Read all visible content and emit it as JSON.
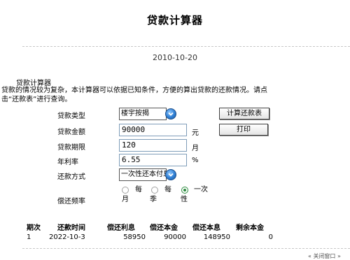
{
  "page": {
    "title": "贷款计算器",
    "date": "2010-10-20"
  },
  "intro": {
    "heading": "贷款计算器",
    "description": "贷款的情况较为复杂，本计算器可以依据已知条件，方便的算出贷款的还款情况。请点击“还款表”进行查询。"
  },
  "form": {
    "loan_type_label": "贷款类型",
    "loan_type_value": "楼宇按揭",
    "amount_label": "贷款金额",
    "amount_value": "90000",
    "amount_unit": "元",
    "term_label": "贷款期限",
    "term_value": "120",
    "term_unit": "月",
    "rate_label": "年利率",
    "rate_value": "6.55",
    "rate_unit": "%",
    "method_label": "还款方式",
    "method_value": "一次性还本付息",
    "frequency_label": "偿还频率",
    "frequency_options": [
      {
        "line1": "每",
        "line2": "月",
        "checked": false
      },
      {
        "line1": "每",
        "line2": "季",
        "checked": false
      },
      {
        "line1": "一次",
        "line2": "性",
        "checked": true
      }
    ]
  },
  "buttons": {
    "calculate": "计算还款表",
    "print": "打印"
  },
  "table": {
    "headers": [
      "期次",
      "还款时间",
      "偿还利息",
      "偿还本金",
      "偿还本息",
      "剩余本金"
    ],
    "rows": [
      [
        "1",
        "2022-10-3",
        "58950",
        "90000",
        "148950",
        "0"
      ]
    ]
  },
  "footer": {
    "link_text": "« 关闭窗口 »"
  },
  "colors": {
    "divider": "#c8c8c8",
    "dropdown_icon": "#2f7fd4",
    "radio_checked": "#2b8a3e"
  },
  "icons": {
    "dropdown": "chevron-down-icon"
  }
}
